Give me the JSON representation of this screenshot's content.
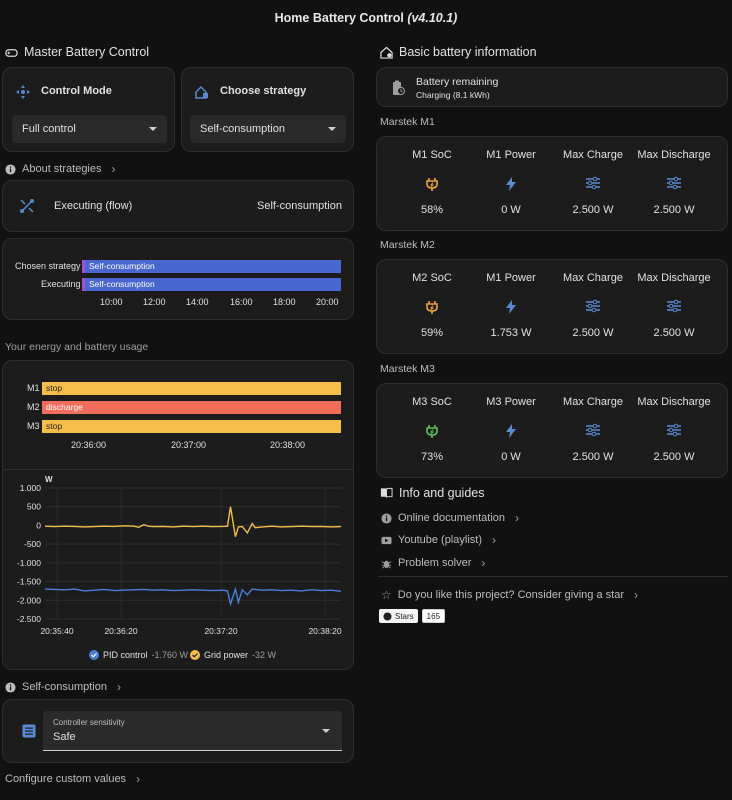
{
  "header": {
    "title": "Home Battery Control",
    "version": "(v4.10.1)"
  },
  "left": {
    "master_title": "Master Battery Control",
    "control_mode": {
      "label": "Control Mode",
      "value": "Full control"
    },
    "choose_strategy": {
      "label": "Choose strategy",
      "value": "Self-consumption"
    },
    "about_strategies": "About strategies",
    "executing": {
      "label": "Executing (flow)",
      "value": "Self-consumption"
    },
    "timeline": {
      "rows": [
        {
          "label": "Chosen strategy",
          "bar": "Self-consumption"
        },
        {
          "label": "Executing",
          "bar": "Self-consumption"
        }
      ],
      "ticks": [
        "10:00",
        "12:00",
        "14:00",
        "16:00",
        "18:00",
        "20:00"
      ]
    },
    "usage_title": "Your energy and battery usage",
    "battery_timeline": {
      "rows": [
        {
          "label": "M1",
          "bar": "stop",
          "color": "#f5bd4a"
        },
        {
          "label": "M2",
          "bar": "discharge",
          "color": "#f26d5b"
        },
        {
          "label": "M3",
          "bar": "stop",
          "color": "#f5bd4a"
        }
      ],
      "ticks": [
        "20:36:00",
        "20:37:00",
        "20:38:00"
      ]
    },
    "power_chart_legend": {
      "pid": {
        "name": "PID control",
        "value": "-1.760 W"
      },
      "grid": {
        "name": "Grid power",
        "value": "-32 W"
      }
    },
    "self_consumption": "Self-consumption",
    "sensitivity": {
      "label": "Controller sensitivity",
      "value": "Safe"
    },
    "configure": "Configure custom values"
  },
  "chart_data": {
    "type": "line",
    "ylabel": "W",
    "ylim": [
      -2500,
      1000
    ],
    "yticks": [
      "1.000",
      "500",
      "0",
      "-500",
      "-1.000",
      "-1.500",
      "-2.000",
      "-2.500"
    ],
    "xticks": [
      "20:35:40",
      "20:36:20",
      "20:37:20",
      "20:38:20"
    ],
    "series": [
      {
        "name": "Grid power",
        "color": "#f5bd4a",
        "points": [
          [
            0,
            -20
          ],
          [
            10,
            -30
          ],
          [
            20,
            -20
          ],
          [
            30,
            -25
          ],
          [
            40,
            -40
          ],
          [
            50,
            -30
          ],
          [
            60,
            -20
          ],
          [
            70,
            -25
          ],
          [
            80,
            -10
          ],
          [
            90,
            -20
          ],
          [
            95,
            -50
          ],
          [
            100,
            20
          ],
          [
            105,
            -20
          ],
          [
            110,
            -30
          ],
          [
            120,
            -25
          ],
          [
            130,
            -40
          ],
          [
            140,
            -20
          ],
          [
            150,
            -30
          ],
          [
            160,
            -20
          ],
          [
            170,
            -30
          ],
          [
            180,
            -25
          ],
          [
            185,
            -20
          ],
          [
            188,
            500
          ],
          [
            193,
            -300
          ],
          [
            196,
            -40
          ],
          [
            200,
            -30
          ],
          [
            205,
            -200
          ],
          [
            210,
            50
          ],
          [
            213,
            -60
          ],
          [
            220,
            -40
          ],
          [
            230,
            -20
          ],
          [
            240,
            -40
          ],
          [
            250,
            -30
          ],
          [
            260,
            -20
          ],
          [
            270,
            -30
          ],
          [
            280,
            -25
          ],
          [
            290,
            -40
          ],
          [
            300,
            -32
          ]
        ]
      },
      {
        "name": "PID control",
        "color": "#4a7fd6",
        "points": [
          [
            0,
            -1700
          ],
          [
            10,
            -1710
          ],
          [
            20,
            -1720
          ],
          [
            30,
            -1700
          ],
          [
            40,
            -1750
          ],
          [
            50,
            -1730
          ],
          [
            60,
            -1710
          ],
          [
            70,
            -1740
          ],
          [
            80,
            -1730
          ],
          [
            90,
            -1720
          ],
          [
            100,
            -1710
          ],
          [
            110,
            -1730
          ],
          [
            120,
            -1720
          ],
          [
            130,
            -1740
          ],
          [
            140,
            -1730
          ],
          [
            150,
            -1720
          ],
          [
            160,
            -1730
          ],
          [
            170,
            -1740
          ],
          [
            180,
            -1730
          ],
          [
            185,
            -1750
          ],
          [
            188,
            -2100
          ],
          [
            193,
            -1700
          ],
          [
            196,
            -2050
          ],
          [
            200,
            -1720
          ],
          [
            205,
            -1850
          ],
          [
            210,
            -1700
          ],
          [
            220,
            -1730
          ],
          [
            230,
            -1720
          ],
          [
            240,
            -1740
          ],
          [
            250,
            -1730
          ],
          [
            260,
            -1750
          ],
          [
            270,
            -1720
          ],
          [
            280,
            -1740
          ],
          [
            290,
            -1730
          ],
          [
            300,
            -1760
          ]
        ]
      }
    ]
  },
  "right": {
    "basic_title": "Basic battery information",
    "remaining": {
      "label": "Battery remaining",
      "value": "Charging (8.1 kWh)"
    },
    "batteries": [
      {
        "name": "Marstek M1",
        "soc_label": "M1 SoC",
        "soc": "58%",
        "soc_color": "#f0a23c",
        "power_label": "M1 Power",
        "power": "0 W",
        "max_charge": "2.500 W",
        "max_discharge": "2.500 W"
      },
      {
        "name": "Marstek M2",
        "soc_label": "M2 SoC",
        "soc": "59%",
        "soc_color": "#f0a23c",
        "power_label": "M1 Power",
        "power": "1.753 W",
        "max_charge": "2.500 W",
        "max_discharge": "2.500 W"
      },
      {
        "name": "Marstek M3",
        "soc_label": "M3 SoC",
        "soc": "73%",
        "soc_color": "#5cc25c",
        "power_label": "M3 Power",
        "power": "0 W",
        "max_charge": "2.500 W",
        "max_discharge": "2.500 W"
      }
    ],
    "max_charge_label": "Max Charge",
    "max_discharge_label": "Max Discharge",
    "info_title": "Info and guides",
    "links": [
      "Online documentation",
      "Youtube (playlist)",
      "Problem solver"
    ],
    "star": "Do you like this project? Consider giving a star",
    "github": {
      "label": "Stars",
      "count": "165"
    }
  }
}
